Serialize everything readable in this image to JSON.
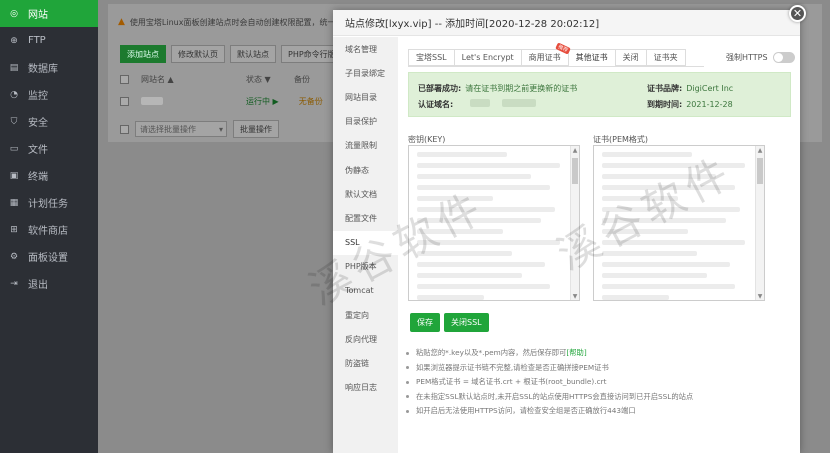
{
  "sidebar": {
    "items": [
      {
        "label": "网站",
        "icon": "globe-icon",
        "glyph": "◎",
        "active": true
      },
      {
        "label": "FTP",
        "icon": "ftp-icon",
        "glyph": "⊕",
        "active": false
      },
      {
        "label": "数据库",
        "icon": "database-icon",
        "glyph": "▤",
        "active": false
      },
      {
        "label": "监控",
        "icon": "monitor-icon",
        "glyph": "◔",
        "active": false
      },
      {
        "label": "安全",
        "icon": "shield-icon",
        "glyph": "⛉",
        "active": false
      },
      {
        "label": "文件",
        "icon": "folder-icon",
        "glyph": "▭",
        "active": false
      },
      {
        "label": "终端",
        "icon": "terminal-icon",
        "glyph": "▣",
        "active": false
      },
      {
        "label": "计划任务",
        "icon": "calendar-icon",
        "glyph": "▦",
        "active": false
      },
      {
        "label": "软件商店",
        "icon": "apps-icon",
        "glyph": "⊞",
        "active": false
      },
      {
        "label": "面板设置",
        "icon": "gear-icon",
        "glyph": "⚙",
        "active": false
      },
      {
        "label": "退出",
        "icon": "logout-icon",
        "glyph": "⇥",
        "active": false
      }
    ]
  },
  "background": {
    "tip": "使用宝塔Linux面板创建站点时会自动创建权限配置，统一使用",
    "buttons": [
      "添加站点",
      "修改默认页",
      "默认站点",
      "PHP命令行版本"
    ],
    "headers": {
      "name": "网站名 ▲",
      "status": "状态 ▼",
      "backup": "备份"
    },
    "row": {
      "status": "运行中 ▶",
      "backup": "无备份"
    },
    "batch_placeholder": "请选择批量操作",
    "batch_button": "批量操作"
  },
  "modal": {
    "title": "站点修改[lxyx.vip] -- 添加时间[2020-12-28 20:02:12]",
    "menu": [
      "域名管理",
      "子目录绑定",
      "网站目录",
      "目录保护",
      "流量限制",
      "伪静态",
      "默认文档",
      "配置文件",
      "SSL",
      "PHP版本",
      "Tomcat",
      "重定向",
      "反向代理",
      "防盗链",
      "响应日志"
    ],
    "active_menu": "SSL",
    "tabs": [
      "宝塔SSL",
      "Let's Encrypt",
      "商用证书",
      "其他证书",
      "关闭",
      "证书夹"
    ],
    "active_tab": "其他证书",
    "rec_badge": "推荐",
    "force_https": "强制HTTPS",
    "cert": {
      "deployed_label": "已部署成功:",
      "deployed_value": "请在证书到期之前更换新的证书",
      "domain_label": "认证域名:",
      "brand_label": "证书品牌:",
      "brand_value": "DigiCert Inc",
      "expire_label": "到期时间:",
      "expire_value": "2021-12-28"
    },
    "key_label": "密钥(KEY)",
    "pem_label": "证书(PEM格式)",
    "save_button": "保存",
    "close_ssl_button": "关闭SSL",
    "tips": [
      {
        "text": "粘贴您的*.key以及*.pem内容，然后保存即可",
        "help": "[帮助]"
      },
      {
        "text": "如果浏览器提示证书链不完整,请检查是否正确拼接PEM证书",
        "help": ""
      },
      {
        "text": "PEM格式证书 = 域名证书.crt + 根证书(root_bundle).crt",
        "help": ""
      },
      {
        "text": "在未指定SSL默认站点时,未开启SSL的站点使用HTTPS会直接访问到已开启SSL的站点",
        "help": ""
      },
      {
        "text": "如开启后无法使用HTTPS访问，请检查安全组是否正确放行443端口",
        "help": ""
      }
    ]
  },
  "watermark": "溪谷软件"
}
